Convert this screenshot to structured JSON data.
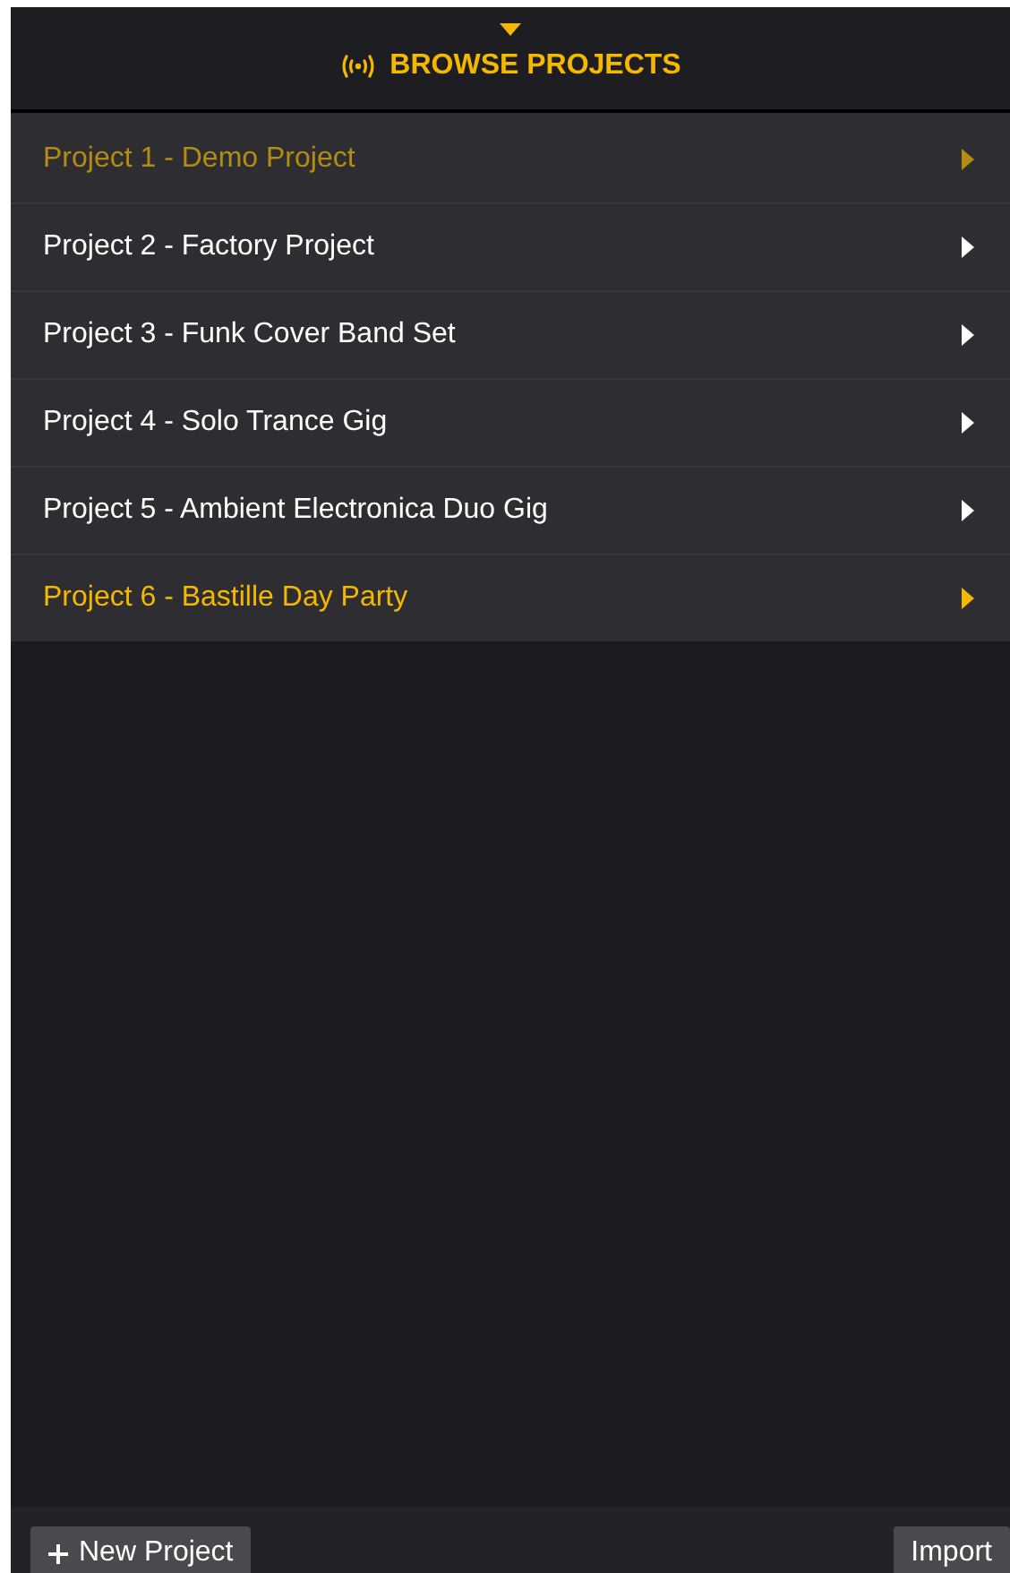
{
  "header": {
    "title": "BROWSE PROJECTS"
  },
  "projects": [
    {
      "label": "Project 1 - Demo Project",
      "active": true,
      "selected": false
    },
    {
      "label": "Project 2 - Factory Project",
      "active": false,
      "selected": false
    },
    {
      "label": "Project 3 - Funk Cover Band Set",
      "active": false,
      "selected": false
    },
    {
      "label": "Project 4 - Solo Trance Gig",
      "active": false,
      "selected": false
    },
    {
      "label": "Project 5 - Ambient Electronica Duo Gig",
      "active": false,
      "selected": false
    },
    {
      "label": "Project 6 - Bastille Day Party",
      "active": false,
      "selected": true
    }
  ],
  "footer": {
    "new_button": "New Project",
    "import_button": "Import"
  }
}
